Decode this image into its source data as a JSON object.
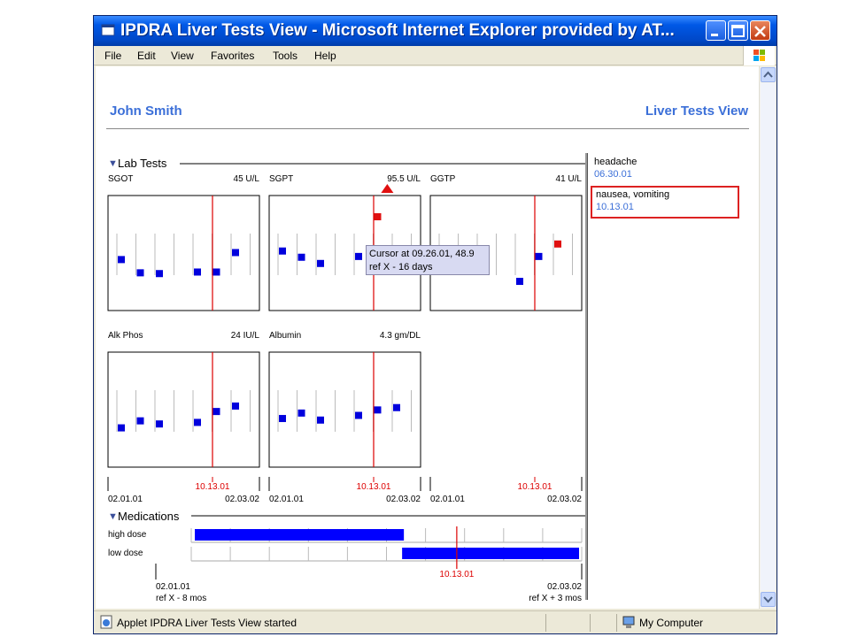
{
  "window": {
    "title": "IPDRA Liver Tests View - Microsoft Internet Explorer provided by AT...",
    "menu": [
      "File",
      "Edit",
      "View",
      "Favorites",
      "Tools",
      "Help"
    ]
  },
  "status": {
    "text": "Applet IPDRA Liver Tests View started",
    "zone": "My Computer"
  },
  "page": {
    "patient_name": "John Smith",
    "view_title": "Liver Tests View"
  },
  "lab_section": {
    "title": "Lab Tests",
    "arrow": "▼"
  },
  "panels": [
    {
      "name": "SGOT",
      "value": "45 U/L",
      "alert": false,
      "points": [
        [
          0,
          0.45
        ],
        [
          1,
          0.28
        ],
        [
          2,
          0.27
        ],
        [
          4,
          0.29
        ],
        [
          5,
          0.29
        ],
        [
          6,
          0.54
        ]
      ]
    },
    {
      "name": "SGPT",
      "value": "95.5 U/L",
      "alert": true,
      "points": [
        [
          0,
          0.56
        ],
        [
          1,
          0.48
        ],
        [
          2,
          0.4
        ],
        [
          4,
          0.49
        ],
        [
          5,
          1.0,
          "red"
        ]
      ]
    },
    {
      "name": "GGTP",
      "value": "41 U/L",
      "alert": false,
      "points": [
        [
          0,
          0.49
        ],
        [
          4,
          0.17
        ],
        [
          5,
          0.49
        ],
        [
          6,
          0.65,
          "red"
        ]
      ]
    },
    {
      "name": "Alk Phos",
      "value": "24 IU/L",
      "alert": false,
      "points": [
        [
          0,
          0.3
        ],
        [
          1,
          0.39
        ],
        [
          2,
          0.35
        ],
        [
          4,
          0.37
        ],
        [
          5,
          0.51
        ],
        [
          6,
          0.58
        ]
      ]
    },
    {
      "name": "Albumin",
      "value": "4.3 gm/DL",
      "alert": false,
      "points": [
        [
          0,
          0.42
        ],
        [
          1,
          0.49
        ],
        [
          2,
          0.4
        ],
        [
          4,
          0.46
        ],
        [
          5,
          0.53
        ],
        [
          6,
          0.56
        ]
      ]
    }
  ],
  "timeline": {
    "start": "02.01.01",
    "end": "02.03.02",
    "ref": "10.13.01"
  },
  "tooltip": {
    "line1": "Cursor at 09.26.01, 48.9",
    "line2": "ref X - 16 days"
  },
  "medications": {
    "title": "Medications",
    "arrow": "▼",
    "rows": [
      "high dose",
      "low dose"
    ],
    "start": "02.01.01",
    "end": "02.03.02",
    "ref": "10.13.01",
    "ref_start": "ref X - 8 mos",
    "ref_end": "ref X + 3 mos",
    "high_dose": {
      "from": 0.0,
      "to": 0.54
    },
    "low_dose": {
      "from": 0.54,
      "to": 1.0
    }
  },
  "events": [
    {
      "label": "headache",
      "date": "06.30.01",
      "selected": false
    },
    {
      "label": "nausea, vomiting",
      "date": "10.13.01",
      "selected": true
    }
  ],
  "colors": {
    "point": "#0000dd",
    "alert": "#e01010",
    "ref": "#dd0000",
    "link": "#3b6fd8"
  }
}
